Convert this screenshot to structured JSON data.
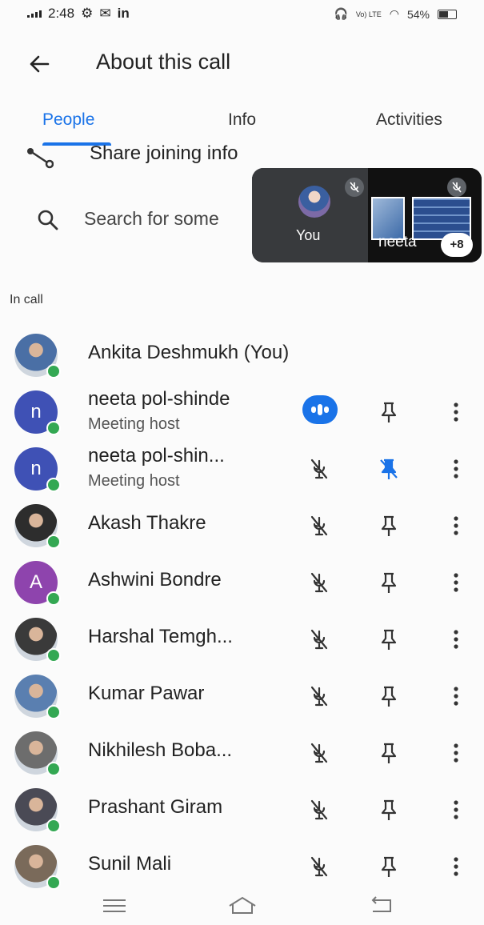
{
  "status_bar": {
    "time": "2:48",
    "app_tag": "in",
    "network": "Vo) LTE",
    "battery": "54%"
  },
  "header": {
    "title": "About this call"
  },
  "tabs": [
    {
      "label": "People",
      "active": true
    },
    {
      "label": "Info",
      "active": false
    },
    {
      "label": "Activities",
      "active": false
    }
  ],
  "share": {
    "label": "Share joining info"
  },
  "search": {
    "placeholder": "Search for some"
  },
  "pip": {
    "self_label": "You",
    "remote_name": "neeta",
    "more_count": "+8"
  },
  "section": {
    "in_call": "In call"
  },
  "participants": [
    {
      "name": "Ankita Deshmukh (You)",
      "subtitle": "",
      "avatar_type": "photo",
      "avatar_color": "#4a6fa5",
      "is_self": true
    },
    {
      "name": "neeta pol-shinde",
      "subtitle": "Meeting host",
      "avatar_type": "letter",
      "initial": "n",
      "avatar_color": "#3f51b5",
      "speaking": true,
      "pinned": false
    },
    {
      "name": "neeta pol-shin...",
      "subtitle": "Meeting host",
      "avatar_type": "letter",
      "initial": "n",
      "avatar_color": "#3f51b5",
      "speaking": false,
      "pinned": true
    },
    {
      "name": "Akash Thakre",
      "subtitle": "",
      "avatar_type": "photo",
      "avatar_color": "#2d2d2d"
    },
    {
      "name": "Ashwini Bondre",
      "subtitle": "",
      "avatar_type": "letter",
      "initial": "A",
      "avatar_color": "#8e44ad"
    },
    {
      "name": "Harshal Temgh...",
      "subtitle": "",
      "avatar_type": "photo",
      "avatar_color": "#3a3a3a"
    },
    {
      "name": "Kumar Pawar",
      "subtitle": "",
      "avatar_type": "photo",
      "avatar_color": "#5a7fb0"
    },
    {
      "name": "Nikhilesh Boba...",
      "subtitle": "",
      "avatar_type": "photo",
      "avatar_color": "#6d6d6d"
    },
    {
      "name": "Prashant Giram",
      "subtitle": "",
      "avatar_type": "photo",
      "avatar_color": "#4a4a55"
    },
    {
      "name": "Sunil Mali",
      "subtitle": "",
      "avatar_type": "photo",
      "avatar_color": "#7a6a5a"
    }
  ],
  "colors": {
    "accent": "#1a73e8",
    "online": "#34a853",
    "pip_bg": "#2f3133"
  },
  "icons": {
    "back": "arrow-left-icon",
    "share": "share-icon",
    "search": "search-icon",
    "mic_off": "mic-off-icon",
    "pin": "pin-icon",
    "pin_off": "pin-off-icon",
    "more": "more-vert-icon",
    "nav_recent": "menu-icon",
    "nav_home": "home-icon",
    "nav_back": "back-nav-icon"
  }
}
